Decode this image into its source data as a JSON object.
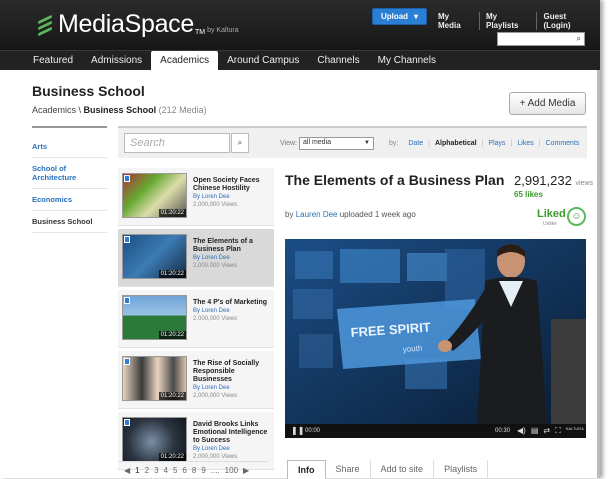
{
  "header": {
    "brand": "MediaSpace",
    "brand_tm": "TM",
    "brand_by": "by Kaltura",
    "upload_label": "Upload",
    "links": [
      "My Media",
      "My Playlists",
      "Guest (Login)"
    ]
  },
  "nav": {
    "items": [
      "Featured",
      "Admissions",
      "Academics",
      "Around Campus",
      "Channels",
      "My Channels"
    ],
    "active": "Academics"
  },
  "page": {
    "title": "Business School",
    "breadcrumb_parent": "Academics \\",
    "breadcrumb_current": "Business School",
    "breadcrumb_count": "(212 Media)",
    "add_media_label": "+ Add Media"
  },
  "sidebar": {
    "items": [
      "Arts",
      "School of Architecture",
      "Economics",
      "Business School"
    ]
  },
  "filter": {
    "search_placeholder": "Search",
    "view_label": "View:",
    "view_value": "all media",
    "by_label": "by:",
    "sort_options": [
      "Date",
      "Alphabetical",
      "Plays",
      "Likes",
      "Comments"
    ],
    "sort_selected": "Alphabetical"
  },
  "media_list": [
    {
      "title": "Open Society Faces Chinese Hostility",
      "by": "By Loren Dee",
      "views": "2,000,000 Views",
      "duration": "01:20:22"
    },
    {
      "title": "The Elements of a Business Plan",
      "by": "By Loren Dee",
      "views": "2,000,000 Views",
      "duration": "01:20:22"
    },
    {
      "title": "The 4 P's of Marketing",
      "by": "By Loren Dee",
      "views": "2,000,000 Views",
      "duration": "01:20:22"
    },
    {
      "title": "The Rise of Socially Responsible Businesses",
      "by": "By Loren Dee",
      "views": "2,000,000 Views",
      "duration": "01:20:22"
    },
    {
      "title": "David Brooks Links Emotional Intelligence to Success",
      "by": "By Loren Dee",
      "views": "2,000,000 Views",
      "duration": "01:20:22"
    }
  ],
  "pager": {
    "prev": "◀",
    "pages": [
      "1",
      "2",
      "3",
      "4",
      "5",
      "6",
      "8",
      "9",
      "....",
      "100"
    ],
    "next": "▶"
  },
  "player": {
    "title": "The Elements of a Business Plan",
    "view_count": "2,991,232",
    "view_unit": "views",
    "likes": "65 likes",
    "uploaded_by_prefix": "by",
    "uploader": "Lauren Dee",
    "uploaded_suffix": "uploaded 1 week ago",
    "liked_label": "Liked",
    "unlike_label": "Unlike",
    "time_current": "00:00",
    "time_total": "00:30",
    "kaltura_mark": "KALTURA",
    "slide_text": "FREE SPIRIT",
    "slide_subtext": "youth"
  },
  "tabs": {
    "items": [
      "Info",
      "Share",
      "Add to site",
      "Playlists"
    ],
    "active": "Info"
  },
  "colors": {
    "link": "#2a6fba",
    "accent_green": "#3c9a2c",
    "upload_blue": "#2a7fd4"
  }
}
